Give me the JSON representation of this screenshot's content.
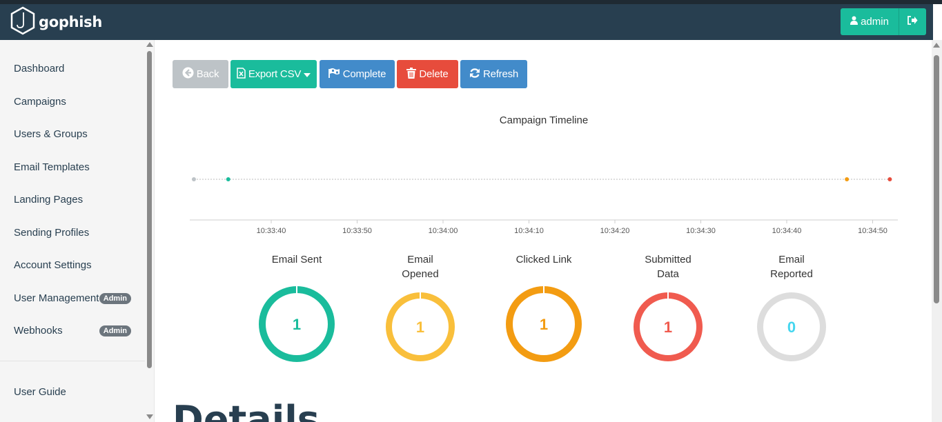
{
  "navbar": {
    "brand": "gophish",
    "user_label": "admin"
  },
  "sidebar": {
    "items": [
      {
        "label": "Dashboard"
      },
      {
        "label": "Campaigns"
      },
      {
        "label": "Users & Groups"
      },
      {
        "label": "Email Templates"
      },
      {
        "label": "Landing Pages"
      },
      {
        "label": "Sending Profiles"
      },
      {
        "label": "Account Settings"
      },
      {
        "label": "User Management",
        "badge": "Admin"
      },
      {
        "label": "Webhooks",
        "badge": "Admin"
      }
    ],
    "footer_item": "User Guide"
  },
  "toolbar": {
    "back": "Back",
    "export": "Export CSV",
    "complete": "Complete",
    "delete": "Delete",
    "refresh": "Refresh"
  },
  "timeline": {
    "title": "Campaign Timeline",
    "ticks": [
      "10:33:40",
      "10:33:50",
      "10:34:00",
      "10:34:10",
      "10:34:20",
      "10:34:30",
      "10:34:40",
      "10:34:50"
    ],
    "events": [
      {
        "time": "10:33:31",
        "color": "#bdc3c7"
      },
      {
        "time": "10:33:35",
        "color": "#1abc9c"
      },
      {
        "time": "10:34:47",
        "color": "#f39c12"
      },
      {
        "time": "10:34:52",
        "color": "#e74c3c"
      }
    ]
  },
  "stats": [
    {
      "line1": "Email Sent",
      "line2": "",
      "value": "1",
      "color": "#1abc9c",
      "fraction": 1
    },
    {
      "line1": "Email",
      "line2": "Opened",
      "value": "1",
      "color": "#f9bf3b",
      "fraction": 1
    },
    {
      "line1": "Clicked Link",
      "line2": "",
      "value": "1",
      "color": "#f39c12",
      "fraction": 1
    },
    {
      "line1": "Submitted",
      "line2": "Data",
      "value": "1",
      "color": "#f05b4f",
      "fraction": 1
    },
    {
      "line1": "Email",
      "line2": "Reported",
      "value": "0",
      "color": "#dddddd",
      "value_color": "#45d6ef",
      "fraction": 0
    }
  ],
  "details_heading": "Details"
}
